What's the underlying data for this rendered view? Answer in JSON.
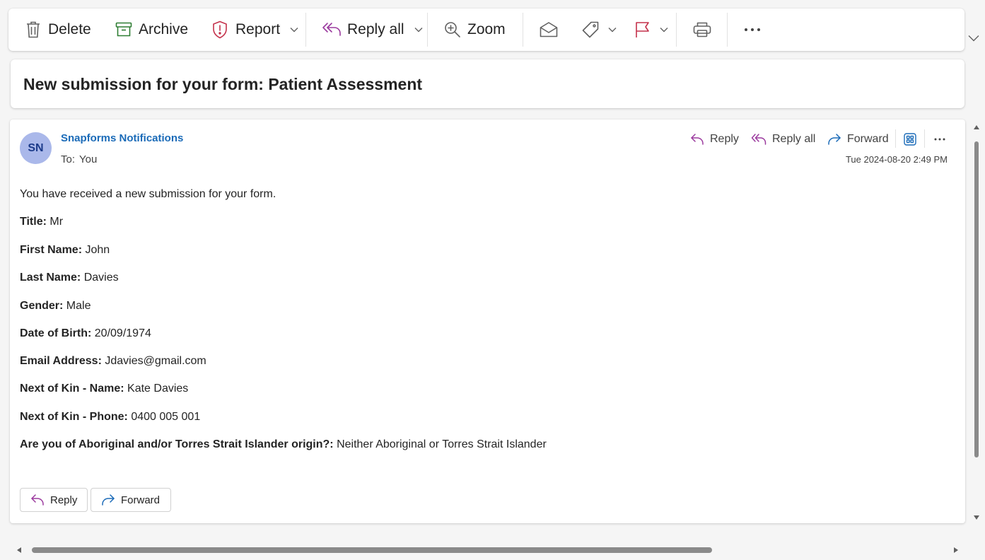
{
  "toolbar": {
    "delete": "Delete",
    "archive": "Archive",
    "report": "Report",
    "reply_all": "Reply all",
    "zoom": "Zoom"
  },
  "colors": {
    "accent": "#1b6bb8",
    "archive_green": "#2e7d32",
    "report_red": "#c4314b",
    "reply_purple": "#9b3a9e",
    "forward_blue": "#1b6bb8",
    "flag_red": "#c4314b",
    "avatar_bg": "#aab8ea"
  },
  "icons": [
    "trash-icon",
    "archive-icon",
    "shield-icon",
    "reply-all-icon",
    "zoom-icon",
    "envelope-open-icon",
    "tag-icon",
    "flag-icon",
    "print-icon",
    "more-icon",
    "chevron-down-icon",
    "reply-icon",
    "forward-icon",
    "immersive-reader-icon"
  ],
  "message": {
    "subject": "New submission for your form: Patient Assessment",
    "avatar_initials": "SN",
    "sender": "Snapforms Notifications",
    "to_label": "To:",
    "to_value": "You",
    "date": "Tue 2024-08-20 2:49 PM",
    "actions": {
      "reply": "Reply",
      "reply_all": "Reply all",
      "forward": "Forward"
    },
    "intro": "You have received a new submission for your form.",
    "fields": [
      {
        "label": "Title:",
        "value": "Mr"
      },
      {
        "label": "First Name:",
        "value": "John"
      },
      {
        "label": "Last Name:",
        "value": "Davies"
      },
      {
        "label": "Gender:",
        "value": "Male"
      },
      {
        "label": "Date of Birth:",
        "value": "20/09/1974"
      },
      {
        "label": "Email Address:",
        "value": "Jdavies@gmail.com"
      },
      {
        "label": "Next of Kin - Name:",
        "value": "Kate Davies"
      },
      {
        "label": "Next of Kin - Phone:",
        "value": "0400 005 001"
      },
      {
        "label": "Are you of Aboriginal and/or Torres Strait Islander origin?:",
        "value": "Neither Aboriginal or Torres Strait Islander"
      }
    ],
    "bottom_reply": "Reply",
    "bottom_forward": "Forward"
  }
}
